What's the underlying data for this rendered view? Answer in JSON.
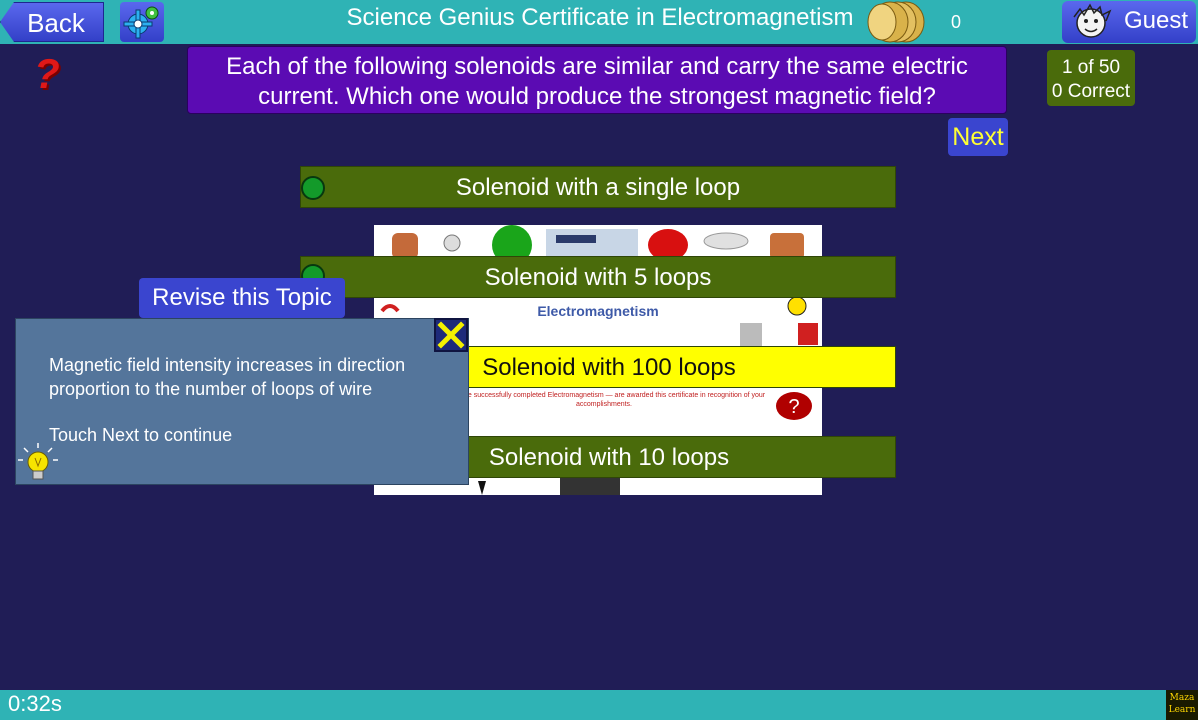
{
  "header": {
    "back_label": "Back",
    "title": "Science Genius Certificate in Electromagnetism",
    "coins": "0",
    "user_label": "Guest"
  },
  "question": {
    "text": "Each of the following solenoids are similar and carry the same electric current. Which one would produce the strongest magnetic field?",
    "counter_line1": "1 of 50",
    "counter_line2": "0 Correct",
    "next_label": "Next"
  },
  "answers": [
    {
      "label": "Solenoid with a single loop"
    },
    {
      "label": "Solenoid with 5 loops"
    },
    {
      "label": "Solenoid with 100 loops"
    },
    {
      "label": "Solenoid with 10 loops"
    }
  ],
  "revise_label": "Revise this Topic",
  "feedback": {
    "text": "Magnetic field intensity increases in direction proportion to the number of loops of wire",
    "continue": "Touch Next to continue"
  },
  "certificate": {
    "title": "Electromagnetism",
    "line": "You have successfully completed Electromagnetism — are awarded this certificate in recognition of your accomplishments."
  },
  "footer": {
    "timer": "0:32s",
    "brand": "Maza Learn"
  }
}
